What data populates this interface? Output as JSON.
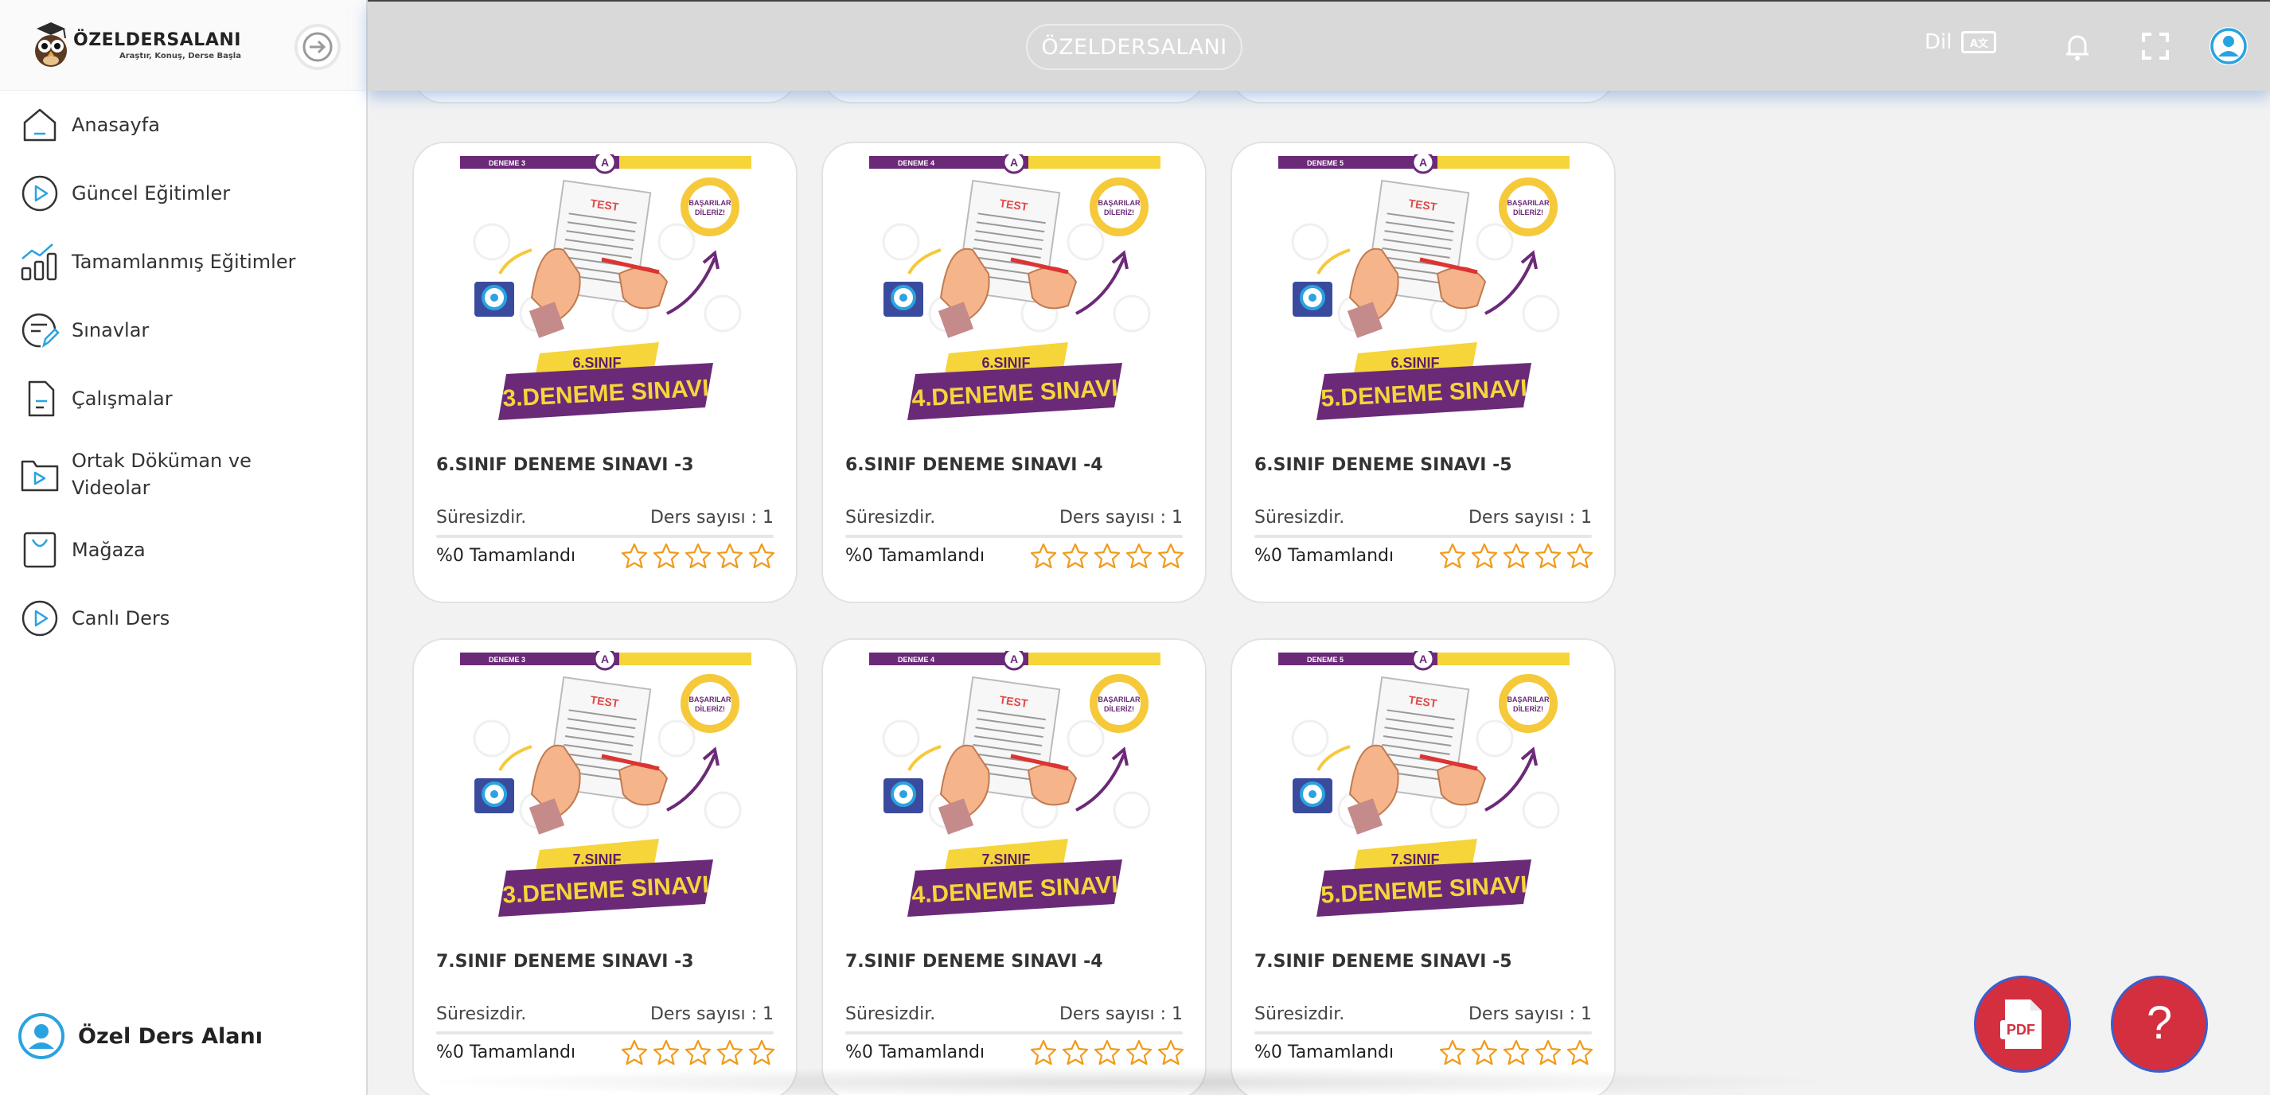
{
  "brand": {
    "name": "ÖZELDERSALANI",
    "tagline": "Araştır, Konuş, Derse Başla",
    "header_title": "ÖZELDERSALANI"
  },
  "header": {
    "language_label": "Dil",
    "language_badge": "A文"
  },
  "sidebar": {
    "items": [
      {
        "label": "Anasayfa",
        "icon": "home-icon"
      },
      {
        "label": "Güncel Eğitimler",
        "icon": "play-circle-icon"
      },
      {
        "label": "Tamamlanmış Eğitimler",
        "icon": "bar-chart-icon"
      },
      {
        "label": "Sınavlar",
        "icon": "exam-edit-icon"
      },
      {
        "label": "Çalışmalar",
        "icon": "document-icon"
      },
      {
        "label": "Ortak Döküman ve Videolar",
        "icon": "folder-video-icon"
      },
      {
        "label": "Mağaza",
        "icon": "shopping-bag-icon"
      },
      {
        "label": "Canlı Ders",
        "icon": "live-play-icon"
      }
    ],
    "user_label": "Özel Ders Alanı"
  },
  "cards": [
    {
      "title": "6.SINIF DENEME SINAVI -3",
      "duration": "Süresizdir.",
      "lessons": "Ders sayısı : 1",
      "progress": "%0 Tamamlandı",
      "rating": 0,
      "thumb": {
        "tag": "DENEME 3",
        "badge": "A",
        "grade": "6.SINIF",
        "exam": "3.DENEME SINAVI",
        "test": "TEST",
        "wish1": "BAŞARILAR",
        "wish2": "DİLERİZ!"
      }
    },
    {
      "title": "6.SINIF DENEME SINAVI -4",
      "duration": "Süresizdir.",
      "lessons": "Ders sayısı : 1",
      "progress": "%0 Tamamlandı",
      "rating": 0,
      "thumb": {
        "tag": "DENEME 4",
        "badge": "A",
        "grade": "6.SINIF",
        "exam": "4.DENEME SINAVI",
        "test": "TEST",
        "wish1": "BAŞARILAR",
        "wish2": "DİLERİZ!"
      }
    },
    {
      "title": "6.SINIF DENEME SINAVI -5",
      "duration": "Süresizdir.",
      "lessons": "Ders sayısı : 1",
      "progress": "%0 Tamamlandı",
      "rating": 0,
      "thumb": {
        "tag": "DENEME 5",
        "badge": "A",
        "grade": "6.SINIF",
        "exam": "5.DENEME SINAVI",
        "test": "TEST",
        "wish1": "BAŞARILAR",
        "wish2": "DİLERİZ!"
      }
    },
    {
      "title": "7.SINIF DENEME SINAVI -3",
      "duration": "Süresizdir.",
      "lessons": "Ders sayısı : 1",
      "progress": "%0 Tamamlandı",
      "rating": 0,
      "thumb": {
        "tag": "DENEME 3",
        "badge": "A",
        "grade": "7.SINIF",
        "exam": "3.DENEME SINAVI",
        "test": "TEST",
        "wish1": "BAŞARILAR",
        "wish2": "DİLERİZ!"
      }
    },
    {
      "title": "7.SINIF DENEME SINAVI -4",
      "duration": "Süresizdir.",
      "lessons": "Ders sayısı : 1",
      "progress": "%0 Tamamlandı",
      "rating": 0,
      "thumb": {
        "tag": "DENEME 4",
        "badge": "A",
        "grade": "7.SINIF",
        "exam": "4.DENEME SINAVI",
        "test": "TEST",
        "wish1": "BAŞARILAR",
        "wish2": "DİLERİZ!"
      }
    },
    {
      "title": "7.SINIF DENEME SINAVI -5",
      "duration": "Süresizdir.",
      "lessons": "Ders sayısı : 1",
      "progress": "%0 Tamamlandı",
      "rating": 0,
      "thumb": {
        "tag": "DENEME 5",
        "badge": "A",
        "grade": "7.SINIF",
        "exam": "5.DENEME SINAVI",
        "test": "TEST",
        "wish1": "BAŞARILAR",
        "wish2": "DİLERİZ!"
      }
    }
  ],
  "fab": {
    "pdf_label": "PDF",
    "help_label": "?"
  },
  "colors": {
    "accent_blue": "#29a3e0",
    "header_bg": "#d9d9d9",
    "thumb_purple": "#6b2a78",
    "thumb_yellow": "#f5d53a",
    "star_orange": "#f19a1b",
    "fab_red": "#d32f3f"
  }
}
